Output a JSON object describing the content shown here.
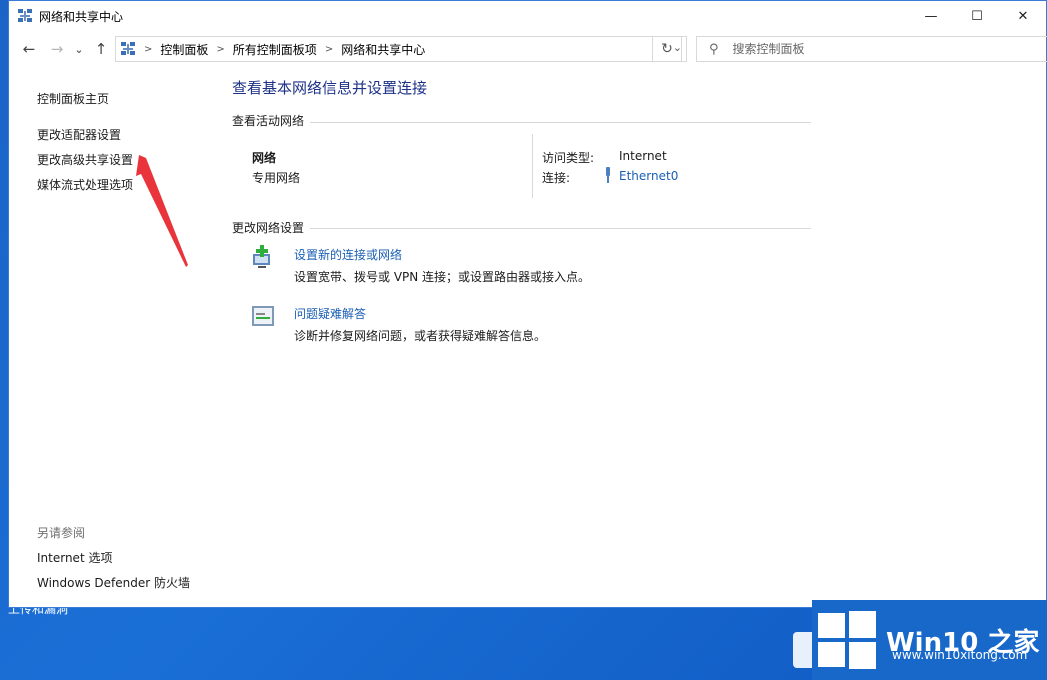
{
  "desktop": {
    "icon_text": "上传和漏洞"
  },
  "window": {
    "title": "网络和共享中心",
    "controls": {
      "minimize": "—",
      "maximize": "☐",
      "close": "✕"
    }
  },
  "nav": {
    "back": "←",
    "forward": "→",
    "recent": "⌄",
    "up": "↑",
    "breadcrumbs": [
      "控制面板",
      "所有控制面板项",
      "网络和共享中心"
    ],
    "refresh": "↻",
    "search_placeholder": "搜索控制面板"
  },
  "sidebar": {
    "home": "控制面板主页",
    "links": [
      "更改适配器设置",
      "更改高级共享设置",
      "媒体流式处理选项"
    ],
    "see_also_heading": "另请参阅",
    "see_also": [
      "Internet 选项",
      "Windows Defender 防火墙"
    ]
  },
  "main": {
    "title": "查看基本网络信息并设置连接",
    "active_networks": {
      "heading": "查看活动网络",
      "network_name": "网络",
      "network_type": "专用网络",
      "access_type_label": "访问类型:",
      "access_type_value": "Internet",
      "connections_label": "连接:",
      "connections_value": "Ethernet0"
    },
    "change_settings": {
      "heading": "更改网络设置",
      "items": [
        {
          "title": "设置新的连接或网络",
          "desc": "设置宽带、拨号或 VPN 连接；或设置路由器或接入点。"
        },
        {
          "title": "问题疑难解答",
          "desc": "诊断并修复网络问题，或者获得疑难解答信息。"
        }
      ]
    }
  },
  "watermark": {
    "brand": "Win10 之家",
    "url": "www.win10xitong.com"
  },
  "colors": {
    "accent": "#1a5fb4",
    "title": "#1e3287",
    "desktop": "#1a6fd6",
    "arrow": "#e8343a"
  }
}
